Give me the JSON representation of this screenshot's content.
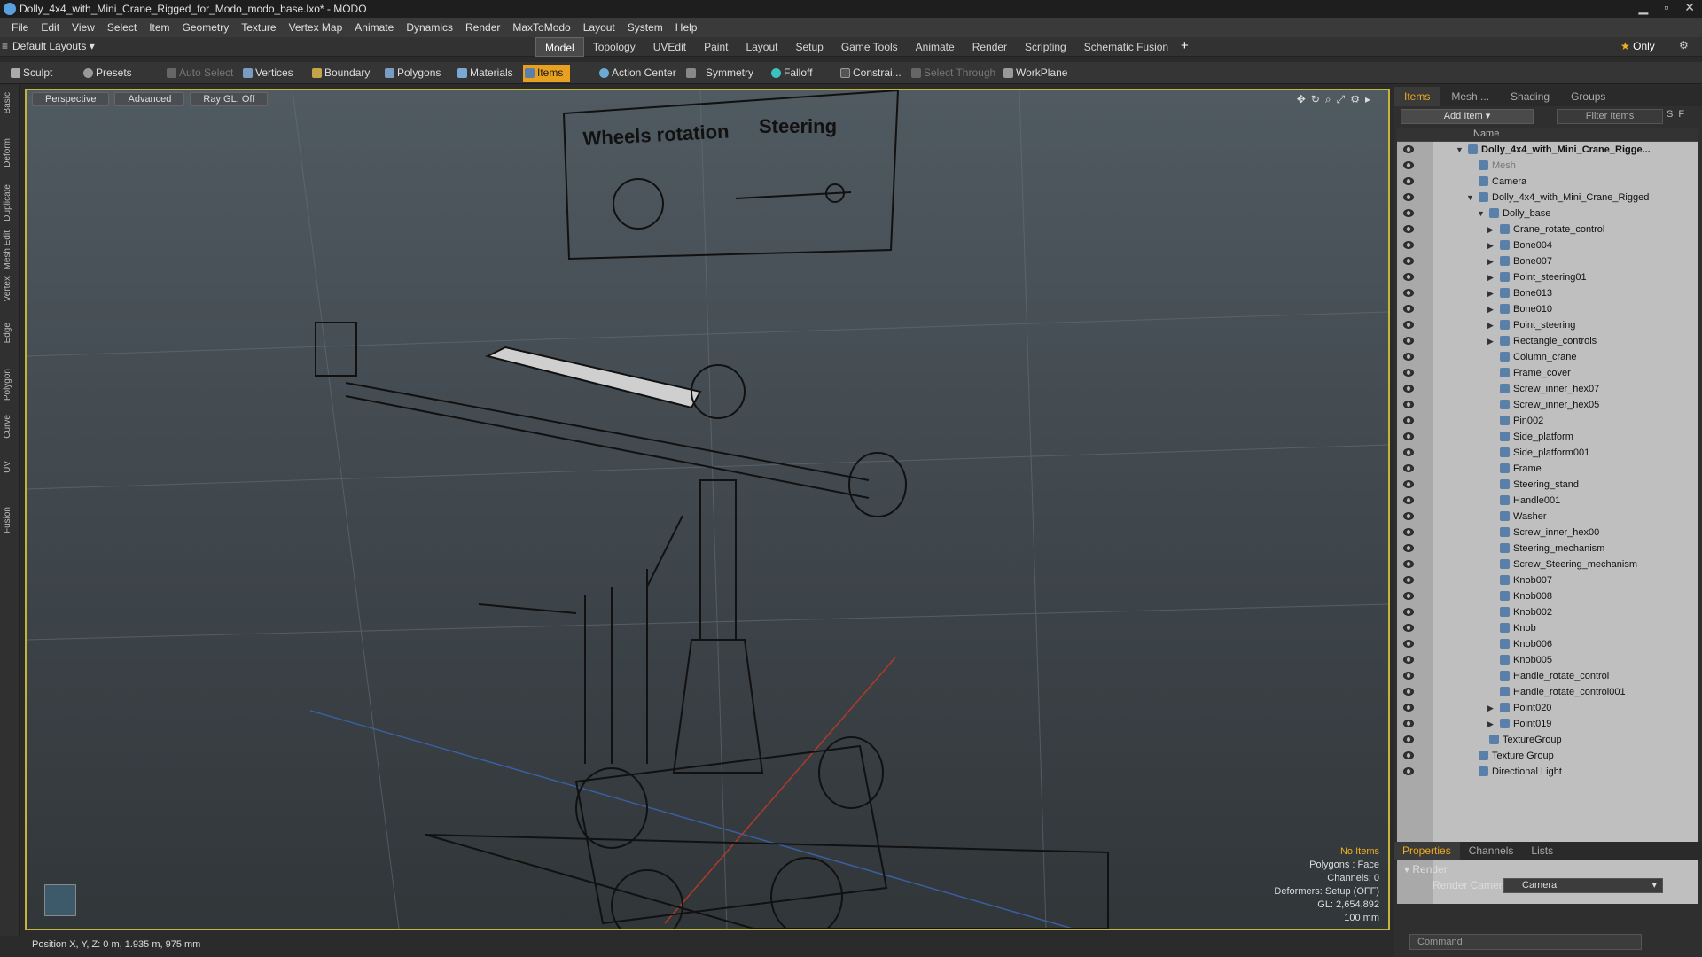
{
  "window": {
    "title": "Dolly_4x4_with_Mini_Crane_Rigged_for_Modo_modo_base.lxo* - MODO"
  },
  "menu": [
    "File",
    "Edit",
    "View",
    "Select",
    "Item",
    "Geometry",
    "Texture",
    "Vertex Map",
    "Animate",
    "Dynamics",
    "Render",
    "MaxToModo",
    "Layout",
    "System",
    "Help"
  ],
  "layouts": "Default Layouts",
  "tabs": [
    "Model",
    "Topology",
    "UVEdit",
    "Paint",
    "Layout",
    "Setup",
    "Game Tools",
    "Animate",
    "Render",
    "Scripting",
    "Schematic Fusion"
  ],
  "only": "Only",
  "toolbar": {
    "sculpt": "Sculpt",
    "presets": "Presets",
    "auto_select": "Auto Select",
    "vertices": "Vertices",
    "boundary": "Boundary",
    "polygons": "Polygons",
    "materials": "Materials",
    "items": "Items",
    "action_center": "Action Center",
    "symmetry": "Symmetry",
    "falloff": "Falloff",
    "constraints": "Constrai...",
    "select_through": "Select Through",
    "workplane": "WorkPlane"
  },
  "left_tabs": [
    "Basic",
    "Deform",
    "Duplicate",
    "Mesh Edit",
    "Vertex",
    "Edge",
    "Polygon",
    "Curve",
    "UV",
    "Fusion"
  ],
  "viewport": {
    "perspective": "Perspective",
    "advanced": "Advanced",
    "raygl": "Ray GL: Off",
    "sign_wheels": "Wheels rotation",
    "sign_steering": "Steering",
    "info": {
      "no_items": "No Items",
      "polygons": "Polygons : Face",
      "channels": "Channels: 0",
      "deformers": "Deformers: Setup (OFF)",
      "gl": "GL: 2,654,892",
      "scale": "100 mm"
    }
  },
  "status": "Position X, Y, Z:  0 m, 1.935 m, 975 mm",
  "right_panel": {
    "tabs": [
      "Items",
      "Mesh ...",
      "Shading",
      "Groups"
    ],
    "add_item": "Add Item",
    "filter": "Filter Items",
    "col_name": "Name",
    "tree": [
      {
        "label": "Dolly_4x4_with_Mini_Crane_Rigge...",
        "indent": 0,
        "arrow": "▼",
        "bold": true
      },
      {
        "label": "Mesh",
        "indent": 1,
        "dim": true
      },
      {
        "label": "Camera",
        "indent": 1
      },
      {
        "label": "Dolly_4x4_with_Mini_Crane_Rigged",
        "indent": 1,
        "arrow": "▼"
      },
      {
        "label": "Dolly_base",
        "indent": 2,
        "arrow": "▼"
      },
      {
        "label": "Crane_rotate_control",
        "indent": 3,
        "arrow": "▶"
      },
      {
        "label": "Bone004",
        "indent": 3,
        "arrow": "▶"
      },
      {
        "label": "Bone007",
        "indent": 3,
        "arrow": "▶"
      },
      {
        "label": "Point_steering01",
        "indent": 3,
        "arrow": "▶"
      },
      {
        "label": "Bone013",
        "indent": 3,
        "arrow": "▶"
      },
      {
        "label": "Bone010",
        "indent": 3,
        "arrow": "▶"
      },
      {
        "label": "Point_steering",
        "indent": 3,
        "arrow": "▶"
      },
      {
        "label": "Rectangle_controls",
        "indent": 3,
        "arrow": "▶"
      },
      {
        "label": "Column_crane",
        "indent": 3
      },
      {
        "label": "Frame_cover",
        "indent": 3
      },
      {
        "label": "Screw_inner_hex07",
        "indent": 3
      },
      {
        "label": "Screw_inner_hex05",
        "indent": 3
      },
      {
        "label": "Pin002",
        "indent": 3
      },
      {
        "label": "Side_platform",
        "indent": 3
      },
      {
        "label": "Side_platform001",
        "indent": 3
      },
      {
        "label": "Frame",
        "indent": 3
      },
      {
        "label": "Steering_stand",
        "indent": 3
      },
      {
        "label": "Handle001",
        "indent": 3
      },
      {
        "label": "Washer",
        "indent": 3
      },
      {
        "label": "Screw_inner_hex00",
        "indent": 3
      },
      {
        "label": "Steering_mechanism",
        "indent": 3
      },
      {
        "label": "Screw_Steering_mechanism",
        "indent": 3
      },
      {
        "label": "Knob007",
        "indent": 3
      },
      {
        "label": "Knob008",
        "indent": 3
      },
      {
        "label": "Knob002",
        "indent": 3
      },
      {
        "label": "Knob",
        "indent": 3
      },
      {
        "label": "Knob006",
        "indent": 3
      },
      {
        "label": "Knob005",
        "indent": 3
      },
      {
        "label": "Handle_rotate_control",
        "indent": 3
      },
      {
        "label": "Handle_rotate_control001",
        "indent": 3
      },
      {
        "label": "Point020",
        "indent": 3,
        "arrow": "▶"
      },
      {
        "label": "Point019",
        "indent": 3,
        "arrow": "▶"
      },
      {
        "label": "TextureGroup",
        "indent": 2
      },
      {
        "label": "Texture Group",
        "indent": 1
      },
      {
        "label": "Directional Light",
        "indent": 1
      }
    ],
    "prop_tabs": [
      "Properties",
      "Channels",
      "Lists"
    ],
    "render_section": "Render",
    "render_camera_label": "Render Camera",
    "render_camera_value": "Camera",
    "command_placeholder": "Command"
  }
}
